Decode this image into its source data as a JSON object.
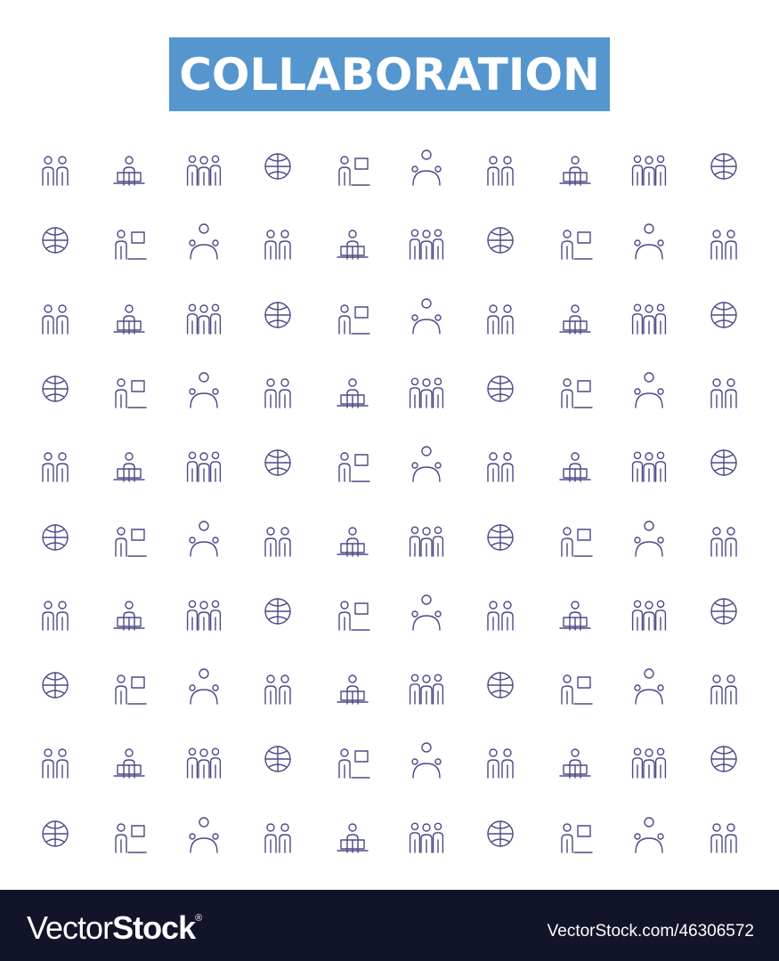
{
  "title": "COLLABORATION",
  "colors": {
    "banner": "#5596cf",
    "icon_stroke": "#4b4a86",
    "footer": "#12142a"
  },
  "icons": {
    "rows": 10,
    "columns": 10,
    "style": "line-art people/teamwork icons"
  },
  "footer": {
    "logo_light": "Vector",
    "logo_bold": "Stock",
    "logo_mark": "®",
    "url": "VectorStock.com/46306572"
  }
}
